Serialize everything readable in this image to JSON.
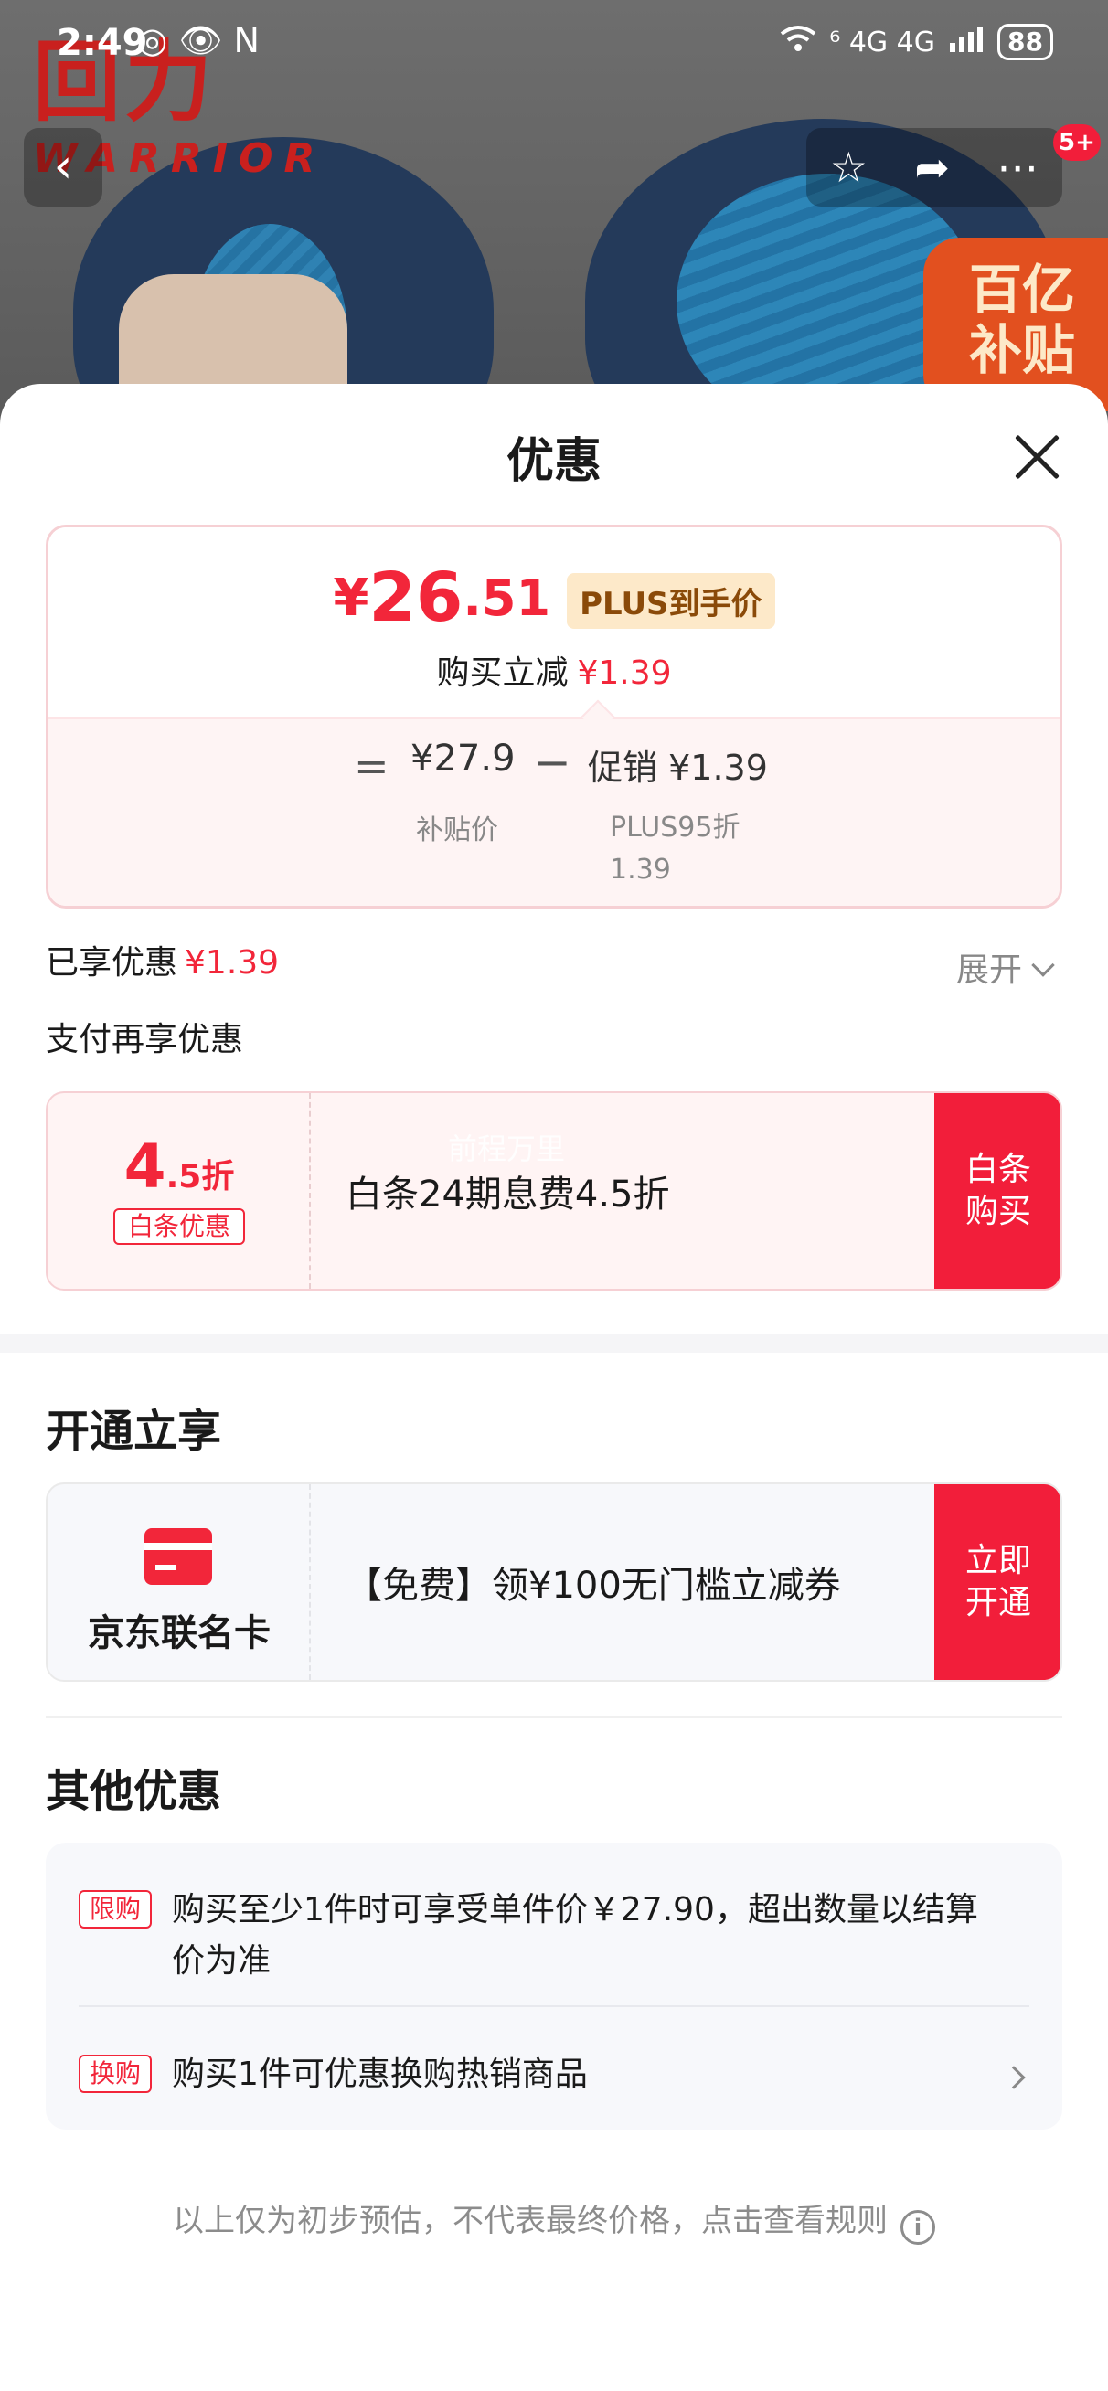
{
  "status_bar": {
    "time": "2:49",
    "left_icons": "◎ 👁 N",
    "network": "⁶ 4G 4G",
    "battery": "88"
  },
  "hero": {
    "brand_text": "回力",
    "brand_subtext": "WARRIOR",
    "subsidy_tag": "百亿\n补贴",
    "badge": "5+"
  },
  "sheet": {
    "title": "优惠",
    "price": {
      "currency": "¥",
      "integer": "26",
      "decimal": ".51",
      "plus_label": "PLUS到手价",
      "reduce_label": "购买立减",
      "reduce_value": "¥1.39"
    },
    "calc": {
      "equals": "=",
      "subsidy_price": "¥27.9",
      "subsidy_label": "补贴价",
      "minus": "−",
      "promo_label": "促销",
      "promo_value": "¥1.39",
      "promo_detail_line1": "PLUS95折",
      "promo_detail_line2": "1.39"
    },
    "enjoyed_label": "已享优惠",
    "enjoyed_value": "¥1.39",
    "expand_label": "展开",
    "pay_more_label": "支付再享优惠",
    "baitiao": {
      "discount_big": "4",
      "discount_small": ".5折",
      "tag": "白条优惠",
      "description": "白条24期息费4.5折",
      "button": "白条\n购买",
      "watermark": "前程万里"
    },
    "open_section_title": "开通立享",
    "card": {
      "name": "京东联名卡",
      "description": "【免费】领¥100无门槛立减券",
      "button": "立即\n开通"
    },
    "other_section_title": "其他优惠",
    "other": [
      {
        "tag": "限购",
        "text": "购买至少1件时可享受单件价￥27.90，超出数量以结算价为准"
      },
      {
        "tag": "换购",
        "text": "购买1件可优惠换购热销商品"
      }
    ],
    "disclaimer": "以上仅为初步预估，不代表最终价格，点击查看规则",
    "info_icon": "i"
  },
  "colors": {
    "accent": "#f2263a",
    "plus_bg": "#fde9c9",
    "plus_text": "#8a4a09"
  }
}
